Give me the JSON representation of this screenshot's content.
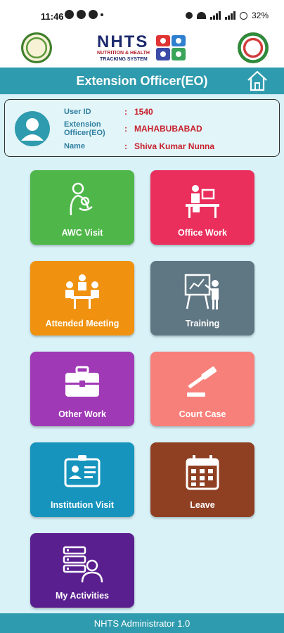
{
  "status": {
    "time": "11:46",
    "battery": "32%"
  },
  "brand": {
    "title": "NHTS",
    "subtitle_line1": "NUTRITION & HEALTH",
    "subtitle_line2": "TRACKING SYSTEM"
  },
  "header": {
    "title": "Extension Officer(EO)"
  },
  "profile": {
    "fields": [
      {
        "label": "User ID",
        "value": "1540"
      },
      {
        "label": "Extension Officer(EO)",
        "value": "MAHABUBABAD"
      },
      {
        "label": "Name",
        "value": "Shiva Kumar Nunna"
      }
    ],
    "colon": ":"
  },
  "tiles": [
    {
      "label": "AWC Visit",
      "color": "#4fb74a",
      "icon": "mother-child-icon"
    },
    {
      "label": "Office Work",
      "color": "#ea2f5c",
      "icon": "office-desk-icon"
    },
    {
      "label": "Attended Meeting",
      "color": "#f0920f",
      "icon": "meeting-icon"
    },
    {
      "label": "Training",
      "color": "#5f7683",
      "icon": "training-board-icon"
    },
    {
      "label": "Other Work",
      "color": "#a039b6",
      "icon": "briefcase-icon"
    },
    {
      "label": "Court Case",
      "color": "#f8807a",
      "icon": "gavel-icon"
    },
    {
      "label": "Institution Visit",
      "color": "#1694bd",
      "icon": "id-card-icon"
    },
    {
      "label": "Leave",
      "color": "#8f3f22",
      "icon": "calendar-icon"
    },
    {
      "label": "My Activities",
      "color": "#5a1f8f",
      "icon": "activities-list-icon"
    }
  ],
  "footer": {
    "text": "NHTS Administrator 1.0"
  }
}
